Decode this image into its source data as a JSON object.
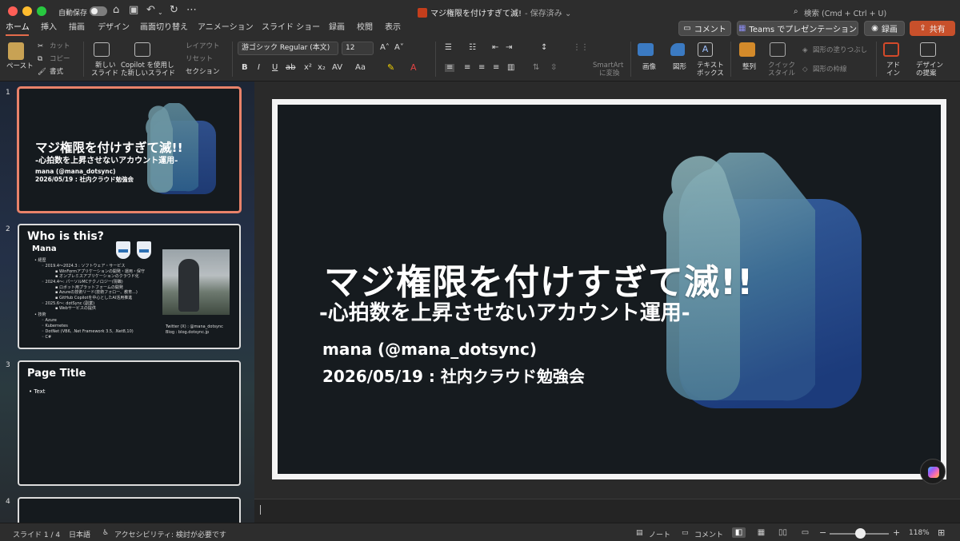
{
  "window": {
    "autosave_label": "自動保存",
    "doc_title": "マジ権限を付けすぎて滅! ",
    "saved_status": "- 保存済み ⌄",
    "search_placeholder": "検索 (Cmd + Ctrl + U)"
  },
  "tabs": [
    "ホーム",
    "挿入",
    "描画",
    "デザイン",
    "画面切り替え",
    "アニメーション",
    "スライド ショー",
    "録画",
    "校閲",
    "表示"
  ],
  "top_buttons": {
    "comment": "コメント",
    "teams": "Teams でプレゼンテーション",
    "record": "録画",
    "share": "共有"
  },
  "ribbon": {
    "paste": "ペースト",
    "cut": "カット",
    "copy": "コピー",
    "format": "書式",
    "new_slide_1": "新しい",
    "new_slide_2": "スライド",
    "copilot_1": "Copilot を使用し",
    "copilot_2": "た新しいスライド",
    "layout": "レイアウト",
    "reset": "リセット",
    "section": "セクション",
    "font_name": "游ゴシック Regular (本文)",
    "font_size": "12",
    "smartart_1": "SmartArt",
    "smartart_2": "に変換",
    "image": "画像",
    "shape": "図形",
    "textbox_1": "テキスト",
    "textbox_2": "ボックス",
    "arrange": "整列",
    "quick_style_1": "クイック",
    "quick_style_2": "スタイル",
    "shape_fill": "図形の塗りつぶし",
    "shape_outline": "図形の枠線",
    "addin_1": "アド",
    "addin_2": "イン",
    "design_1": "デザイン",
    "design_2": "の提案"
  },
  "slides": [
    {
      "number": "1",
      "title": "マジ権限を付けすぎて滅!!",
      "subtitle": "-心拍数を上昇させないアカウント運用-",
      "author": "mana (@mana_dotsync)",
      "event": "2026/05/19 : 社内クラウド勉強会"
    },
    {
      "number": "2",
      "title": "Who is this?",
      "name": "Mana",
      "lines": [
        "• 経歴",
        "◦ 2019.4～2024.3 : ソフトウェア・サービス",
        "▪ WinFormアプリケーションの開発・運用・保守",
        "▪ オンプレミスアプリケーションのクラウド化",
        "◦ 2024.4～: パーソルMCテクノロジー(現職)",
        "▪ ロボット用プラットフォームの開発",
        "▪ Azureの技術リード(技術フォロー、教育...)",
        "▪ GitHub Copilotを中心としたAI活用推進",
        "◦ 2025.6～: dotSync (副業)",
        "▪ Webサービスの提供",
        "• 技術",
        "◦ Azure",
        "◦ Kubernetes",
        "◦ DotNet (VB6, .Net Framework 3.5, .Net8,10)",
        "◦ C#"
      ],
      "twitter": "Twitter (X) : @mana_dotsync",
      "blog": "Blog : blog.dotsync.jp"
    },
    {
      "number": "3",
      "title": "Page Title",
      "text": "• Text"
    },
    {
      "number": "4"
    }
  ],
  "main_slide": {
    "title": "マジ権限を付けすぎて滅!!",
    "subtitle": "-心拍数を上昇させないアカウント運用-",
    "author": "mana (@mana_dotsync)",
    "event": "2026/05/19 : 社内クラウド勉強会"
  },
  "status": {
    "slide_counter": "スライド 1 / 4",
    "language": "日本語",
    "accessibility": "アクセシビリティ: 検討が必要です",
    "notes": "ノート",
    "comments": "コメント",
    "zoom": "118%"
  },
  "colors": {
    "accent": "#e46b4b",
    "share": "#c8502b",
    "slide_bg": "#161b1f",
    "logo_front": "#6d9aa6",
    "logo_back": "#1f4a8a"
  },
  "icons": [
    "paste-icon",
    "cut-icon",
    "copy-icon",
    "format-painter-icon",
    "new-slide-icon",
    "image-icon",
    "shape-icon",
    "textbox-icon",
    "arrange-icon",
    "search-icon",
    "comment-icon",
    "teams-icon",
    "record-icon",
    "share-icon",
    "copilot-icon"
  ]
}
